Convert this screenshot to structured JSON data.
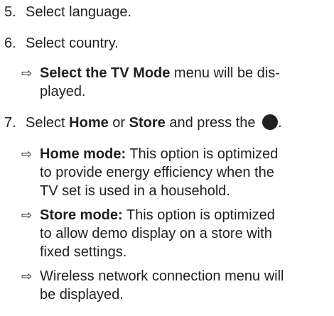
{
  "steps": [
    {
      "num": "5.",
      "text": "Select language."
    },
    {
      "num": "6.",
      "text": "Select country."
    },
    {
      "num": "7.",
      "pre": "Select ",
      "bold1": "Home",
      "mid": " or ",
      "bold2": "Store",
      "post": " and press the ",
      "end": "."
    }
  ],
  "results": {
    "tv_mode": {
      "arrow": "⇨",
      "bold": "Select the TV Mode",
      "line1_rest": " menu will be dis-",
      "line2": "played."
    },
    "home_mode": {
      "arrow": "⇨",
      "bold": "Home mode:",
      "line1_rest": " This option is optimized",
      "line2": "to provide energy efficiency when the",
      "line3": "TV set is used in a household."
    },
    "store_mode": {
      "arrow": "⇨",
      "bold": "Store mode:",
      "line1_rest": " This option is optimized",
      "line2": "to allow demo display on a store with",
      "line3": "fixed settings."
    },
    "wireless": {
      "arrow": "⇨",
      "line1": "Wireless network connection menu will",
      "line2": "be displayed."
    }
  },
  "icons": {
    "ok_button": "filled-circle-ok-button-icon"
  }
}
